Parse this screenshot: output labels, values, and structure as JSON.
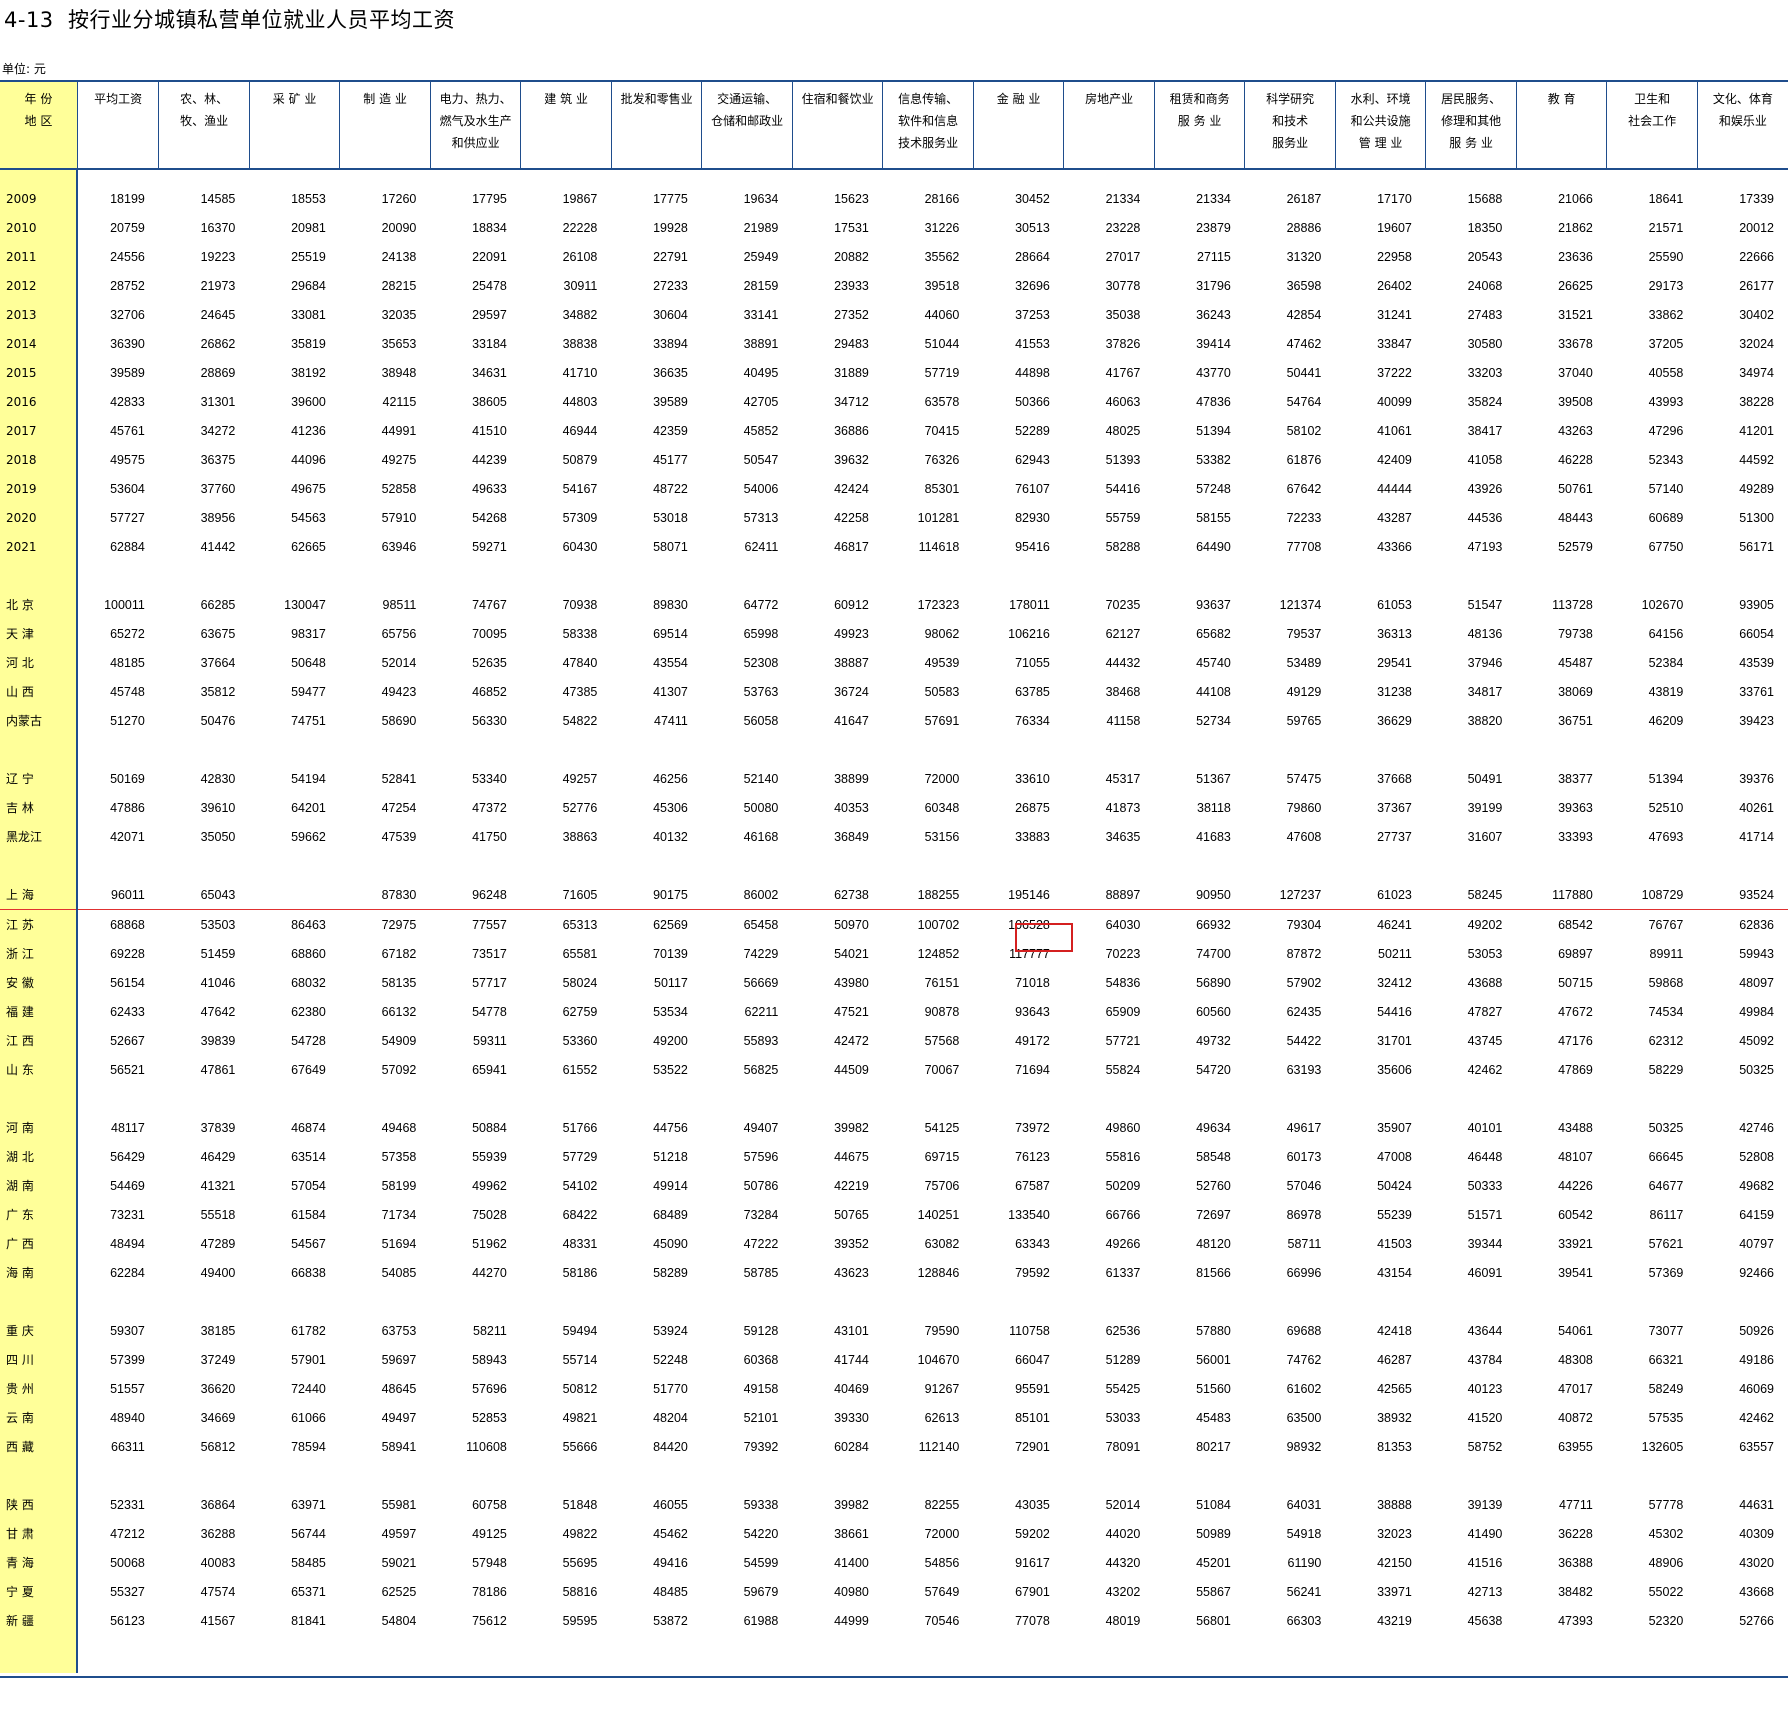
{
  "header": {
    "code": "4-13",
    "title": "按行业分城镇私营单位就业人员平均工资",
    "unit": "单位: 元"
  },
  "columns": [
    [
      "年 份",
      "地 区"
    ],
    [
      "平均工资"
    ],
    [
      "农、林、",
      "牧、渔业"
    ],
    [
      "采 矿 业"
    ],
    [
      "制 造 业"
    ],
    [
      "电力、热力、",
      "燃气及水生产",
      "和供应业"
    ],
    [
      "建 筑 业"
    ],
    [
      "批发和零售业"
    ],
    [
      "交通运输、",
      "仓储和邮政业"
    ],
    [
      "住宿和餐饮业"
    ],
    [
      "信息传输、",
      "软件和信息",
      "技术服务业"
    ],
    [
      "金 融 业"
    ],
    [
      "房地产业"
    ],
    [
      "租赁和商务",
      "服 务 业"
    ],
    [
      "科学研究",
      "和技术",
      "服务业"
    ],
    [
      "水利、环境",
      "和公共设施",
      "管 理 业"
    ],
    [
      "居民服务、",
      "修理和其他",
      "服 务 业"
    ],
    [
      "教 育"
    ],
    [
      "卫生和",
      "社会工作"
    ],
    [
      "文化、体育",
      "和娱乐业"
    ]
  ],
  "groups": [
    [
      [
        "2009",
        "18199",
        "14585",
        "18553",
        "17260",
        "17795",
        "19867",
        "17775",
        "19634",
        "15623",
        "28166",
        "30452",
        "21334",
        "21334",
        "26187",
        "17170",
        "15688",
        "21066",
        "18641",
        "17339"
      ],
      [
        "2010",
        "20759",
        "16370",
        "20981",
        "20090",
        "18834",
        "22228",
        "19928",
        "21989",
        "17531",
        "31226",
        "30513",
        "23228",
        "23879",
        "28886",
        "19607",
        "18350",
        "21862",
        "21571",
        "20012"
      ],
      [
        "2011",
        "24556",
        "19223",
        "25519",
        "24138",
        "22091",
        "26108",
        "22791",
        "25949",
        "20882",
        "35562",
        "28664",
        "27017",
        "27115",
        "31320",
        "22958",
        "20543",
        "23636",
        "25590",
        "22666"
      ],
      [
        "2012",
        "28752",
        "21973",
        "29684",
        "28215",
        "25478",
        "30911",
        "27233",
        "28159",
        "23933",
        "39518",
        "32696",
        "30778",
        "31796",
        "36598",
        "26402",
        "24068",
        "26625",
        "29173",
        "26177"
      ],
      [
        "2013",
        "32706",
        "24645",
        "33081",
        "32035",
        "29597",
        "34882",
        "30604",
        "33141",
        "27352",
        "44060",
        "37253",
        "35038",
        "36243",
        "42854",
        "31241",
        "27483",
        "31521",
        "33862",
        "30402"
      ],
      [
        "2014",
        "36390",
        "26862",
        "35819",
        "35653",
        "33184",
        "38838",
        "33894",
        "38891",
        "29483",
        "51044",
        "41553",
        "37826",
        "39414",
        "47462",
        "33847",
        "30580",
        "33678",
        "37205",
        "32024"
      ],
      [
        "2015",
        "39589",
        "28869",
        "38192",
        "38948",
        "34631",
        "41710",
        "36635",
        "40495",
        "31889",
        "57719",
        "44898",
        "41767",
        "43770",
        "50441",
        "37222",
        "33203",
        "37040",
        "40558",
        "34974"
      ],
      [
        "2016",
        "42833",
        "31301",
        "39600",
        "42115",
        "38605",
        "44803",
        "39589",
        "42705",
        "34712",
        "63578",
        "50366",
        "46063",
        "47836",
        "54764",
        "40099",
        "35824",
        "39508",
        "43993",
        "38228"
      ],
      [
        "2017",
        "45761",
        "34272",
        "41236",
        "44991",
        "41510",
        "46944",
        "42359",
        "45852",
        "36886",
        "70415",
        "52289",
        "48025",
        "51394",
        "58102",
        "41061",
        "38417",
        "43263",
        "47296",
        "41201"
      ],
      [
        "2018",
        "49575",
        "36375",
        "44096",
        "49275",
        "44239",
        "50879",
        "45177",
        "50547",
        "39632",
        "76326",
        "62943",
        "51393",
        "53382",
        "61876",
        "42409",
        "41058",
        "46228",
        "52343",
        "44592"
      ],
      [
        "2019",
        "53604",
        "37760",
        "49675",
        "52858",
        "49633",
        "54167",
        "48722",
        "54006",
        "42424",
        "85301",
        "76107",
        "54416",
        "57248",
        "67642",
        "44444",
        "43926",
        "50761",
        "57140",
        "49289"
      ],
      [
        "2020",
        "57727",
        "38956",
        "54563",
        "57910",
        "54268",
        "57309",
        "53018",
        "57313",
        "42258",
        "101281",
        "82930",
        "55759",
        "58155",
        "72233",
        "43287",
        "44536",
        "48443",
        "60689",
        "51300"
      ],
      [
        "2021",
        "62884",
        "41442",
        "62665",
        "63946",
        "59271",
        "60430",
        "58071",
        "62411",
        "46817",
        "114618",
        "95416",
        "58288",
        "64490",
        "77708",
        "43366",
        "47193",
        "52579",
        "67750",
        "56171"
      ]
    ],
    [
      [
        "北 京",
        "100011",
        "66285",
        "130047",
        "98511",
        "74767",
        "70938",
        "89830",
        "64772",
        "60912",
        "172323",
        "178011",
        "70235",
        "93637",
        "121374",
        "61053",
        "51547",
        "113728",
        "102670",
        "93905"
      ],
      [
        "天 津",
        "65272",
        "63675",
        "98317",
        "65756",
        "70095",
        "58338",
        "69514",
        "65998",
        "49923",
        "98062",
        "106216",
        "62127",
        "65682",
        "79537",
        "36313",
        "48136",
        "79738",
        "64156",
        "66054"
      ],
      [
        "河 北",
        "48185",
        "37664",
        "50648",
        "52014",
        "52635",
        "47840",
        "43554",
        "52308",
        "38887",
        "49539",
        "71055",
        "44432",
        "45740",
        "53489",
        "29541",
        "37946",
        "45487",
        "52384",
        "43539"
      ],
      [
        "山 西",
        "45748",
        "35812",
        "59477",
        "49423",
        "46852",
        "47385",
        "41307",
        "53763",
        "36724",
        "50583",
        "63785",
        "38468",
        "44108",
        "49129",
        "31238",
        "34817",
        "38069",
        "43819",
        "33761"
      ],
      [
        "内蒙古",
        "51270",
        "50476",
        "74751",
        "58690",
        "56330",
        "54822",
        "47411",
        "56058",
        "41647",
        "57691",
        "76334",
        "41158",
        "52734",
        "59765",
        "36629",
        "38820",
        "36751",
        "46209",
        "39423"
      ]
    ],
    [
      [
        "辽 宁",
        "50169",
        "42830",
        "54194",
        "52841",
        "53340",
        "49257",
        "46256",
        "52140",
        "38899",
        "72000",
        "33610",
        "45317",
        "51367",
        "57475",
        "37668",
        "50491",
        "38377",
        "51394",
        "39376"
      ],
      [
        "吉 林",
        "47886",
        "39610",
        "64201",
        "47254",
        "47372",
        "52776",
        "45306",
        "50080",
        "40353",
        "60348",
        "26875",
        "41873",
        "38118",
        "79860",
        "37367",
        "39199",
        "39363",
        "52510",
        "40261"
      ],
      [
        "黑龙江",
        "42071",
        "35050",
        "59662",
        "47539",
        "41750",
        "38863",
        "40132",
        "46168",
        "36849",
        "53156",
        "33883",
        "34635",
        "41683",
        "47608",
        "27737",
        "31607",
        "33393",
        "47693",
        "41714"
      ]
    ],
    [
      [
        "上 海",
        "96011",
        "65043",
        "",
        "87830",
        "96248",
        "71605",
        "90175",
        "86002",
        "62738",
        "188255",
        "195146",
        "88897",
        "90950",
        "127237",
        "61023",
        "58245",
        "117880",
        "108729",
        "93524"
      ],
      [
        "江 苏",
        "68868",
        "53503",
        "86463",
        "72975",
        "77557",
        "65313",
        "62569",
        "65458",
        "50970",
        "100702",
        "106528",
        "64030",
        "66932",
        "79304",
        "46241",
        "49202",
        "68542",
        "76767",
        "62836"
      ],
      [
        "浙 江",
        "69228",
        "51459",
        "68860",
        "67182",
        "73517",
        "65581",
        "70139",
        "74229",
        "54021",
        "124852",
        "117777",
        "70223",
        "74700",
        "87872",
        "50211",
        "53053",
        "69897",
        "89911",
        "59943"
      ],
      [
        "安 徽",
        "56154",
        "41046",
        "68032",
        "58135",
        "57717",
        "58024",
        "50117",
        "56669",
        "43980",
        "76151",
        "71018",
        "54836",
        "56890",
        "57902",
        "32412",
        "43688",
        "50715",
        "59868",
        "48097"
      ],
      [
        "福 建",
        "62433",
        "47642",
        "62380",
        "66132",
        "54778",
        "62759",
        "53534",
        "62211",
        "47521",
        "90878",
        "93643",
        "65909",
        "60560",
        "62435",
        "54416",
        "47827",
        "47672",
        "74534",
        "49984"
      ],
      [
        "江 西",
        "52667",
        "39839",
        "54728",
        "54909",
        "59311",
        "53360",
        "49200",
        "55893",
        "42472",
        "57568",
        "49172",
        "57721",
        "49732",
        "54422",
        "31701",
        "43745",
        "47176",
        "62312",
        "45092"
      ],
      [
        "山 东",
        "56521",
        "47861",
        "67649",
        "57092",
        "65941",
        "61552",
        "53522",
        "56825",
        "44509",
        "70067",
        "71694",
        "55824",
        "54720",
        "63193",
        "35606",
        "42462",
        "47869",
        "58229",
        "50325"
      ]
    ],
    [
      [
        "河 南",
        "48117",
        "37839",
        "46874",
        "49468",
        "50884",
        "51766",
        "44756",
        "49407",
        "39982",
        "54125",
        "73972",
        "49860",
        "49634",
        "49617",
        "35907",
        "40101",
        "43488",
        "50325",
        "42746"
      ],
      [
        "湖 北",
        "56429",
        "46429",
        "63514",
        "57358",
        "55939",
        "57729",
        "51218",
        "57596",
        "44675",
        "69715",
        "76123",
        "55816",
        "58548",
        "60173",
        "47008",
        "46448",
        "48107",
        "66645",
        "52808"
      ],
      [
        "湖 南",
        "54469",
        "41321",
        "57054",
        "58199",
        "49962",
        "54102",
        "49914",
        "50786",
        "42219",
        "75706",
        "67587",
        "50209",
        "52760",
        "57046",
        "50424",
        "50333",
        "44226",
        "64677",
        "49682"
      ],
      [
        "广 东",
        "73231",
        "55518",
        "61584",
        "71734",
        "75028",
        "68422",
        "68489",
        "73284",
        "50765",
        "140251",
        "133540",
        "66766",
        "72697",
        "86978",
        "55239",
        "51571",
        "60542",
        "86117",
        "64159"
      ],
      [
        "广 西",
        "48494",
        "47289",
        "54567",
        "51694",
        "51962",
        "48331",
        "45090",
        "47222",
        "39352",
        "63082",
        "63343",
        "49266",
        "48120",
        "58711",
        "41503",
        "39344",
        "33921",
        "57621",
        "40797"
      ],
      [
        "海 南",
        "62284",
        "49400",
        "66838",
        "54085",
        "44270",
        "58186",
        "58289",
        "58785",
        "43623",
        "128846",
        "79592",
        "61337",
        "81566",
        "66996",
        "43154",
        "46091",
        "39541",
        "57369",
        "92466"
      ]
    ],
    [
      [
        "重 庆",
        "59307",
        "38185",
        "61782",
        "63753",
        "58211",
        "59494",
        "53924",
        "59128",
        "43101",
        "79590",
        "110758",
        "62536",
        "57880",
        "69688",
        "42418",
        "43644",
        "54061",
        "73077",
        "50926"
      ],
      [
        "四 川",
        "57399",
        "37249",
        "57901",
        "59697",
        "58943",
        "55714",
        "52248",
        "60368",
        "41744",
        "104670",
        "66047",
        "51289",
        "56001",
        "74762",
        "46287",
        "43784",
        "48308",
        "66321",
        "49186"
      ],
      [
        "贵 州",
        "51557",
        "36620",
        "72440",
        "48645",
        "57696",
        "50812",
        "51770",
        "49158",
        "40469",
        "91267",
        "95591",
        "55425",
        "51560",
        "61602",
        "42565",
        "40123",
        "47017",
        "58249",
        "46069"
      ],
      [
        "云 南",
        "48940",
        "34669",
        "61066",
        "49497",
        "52853",
        "49821",
        "48204",
        "52101",
        "39330",
        "62613",
        "85101",
        "53033",
        "45483",
        "63500",
        "38932",
        "41520",
        "40872",
        "57535",
        "42462"
      ],
      [
        "西 藏",
        "66311",
        "56812",
        "78594",
        "58941",
        "110608",
        "55666",
        "84420",
        "79392",
        "60284",
        "112140",
        "72901",
        "78091",
        "80217",
        "98932",
        "81353",
        "58752",
        "63955",
        "132605",
        "63557"
      ]
    ],
    [
      [
        "陕 西",
        "52331",
        "36864",
        "63971",
        "55981",
        "60758",
        "51848",
        "46055",
        "59338",
        "39982",
        "82255",
        "43035",
        "52014",
        "51084",
        "64031",
        "38888",
        "39139",
        "47711",
        "57778",
        "44631"
      ],
      [
        "甘 肃",
        "47212",
        "36288",
        "56744",
        "49597",
        "49125",
        "49822",
        "45462",
        "54220",
        "38661",
        "72000",
        "59202",
        "44020",
        "50989",
        "54918",
        "32023",
        "41490",
        "36228",
        "45302",
        "40309"
      ],
      [
        "青 海",
        "50068",
        "40083",
        "58485",
        "59021",
        "57948",
        "55695",
        "49416",
        "54599",
        "41400",
        "54856",
        "91617",
        "44320",
        "45201",
        "61190",
        "42150",
        "41516",
        "36388",
        "48906",
        "43020"
      ],
      [
        "宁 夏",
        "55327",
        "47574",
        "65371",
        "62525",
        "78186",
        "58816",
        "48485",
        "59679",
        "40980",
        "57649",
        "67901",
        "43202",
        "55867",
        "56241",
        "33971",
        "42713",
        "38482",
        "55022",
        "43668"
      ],
      [
        "新 疆",
        "56123",
        "41567",
        "81841",
        "54804",
        "75612",
        "59595",
        "53872",
        "61988",
        "44999",
        "70546",
        "77078",
        "48019",
        "56801",
        "66303",
        "43219",
        "45638",
        "47393",
        "52320",
        "52766"
      ]
    ]
  ]
}
